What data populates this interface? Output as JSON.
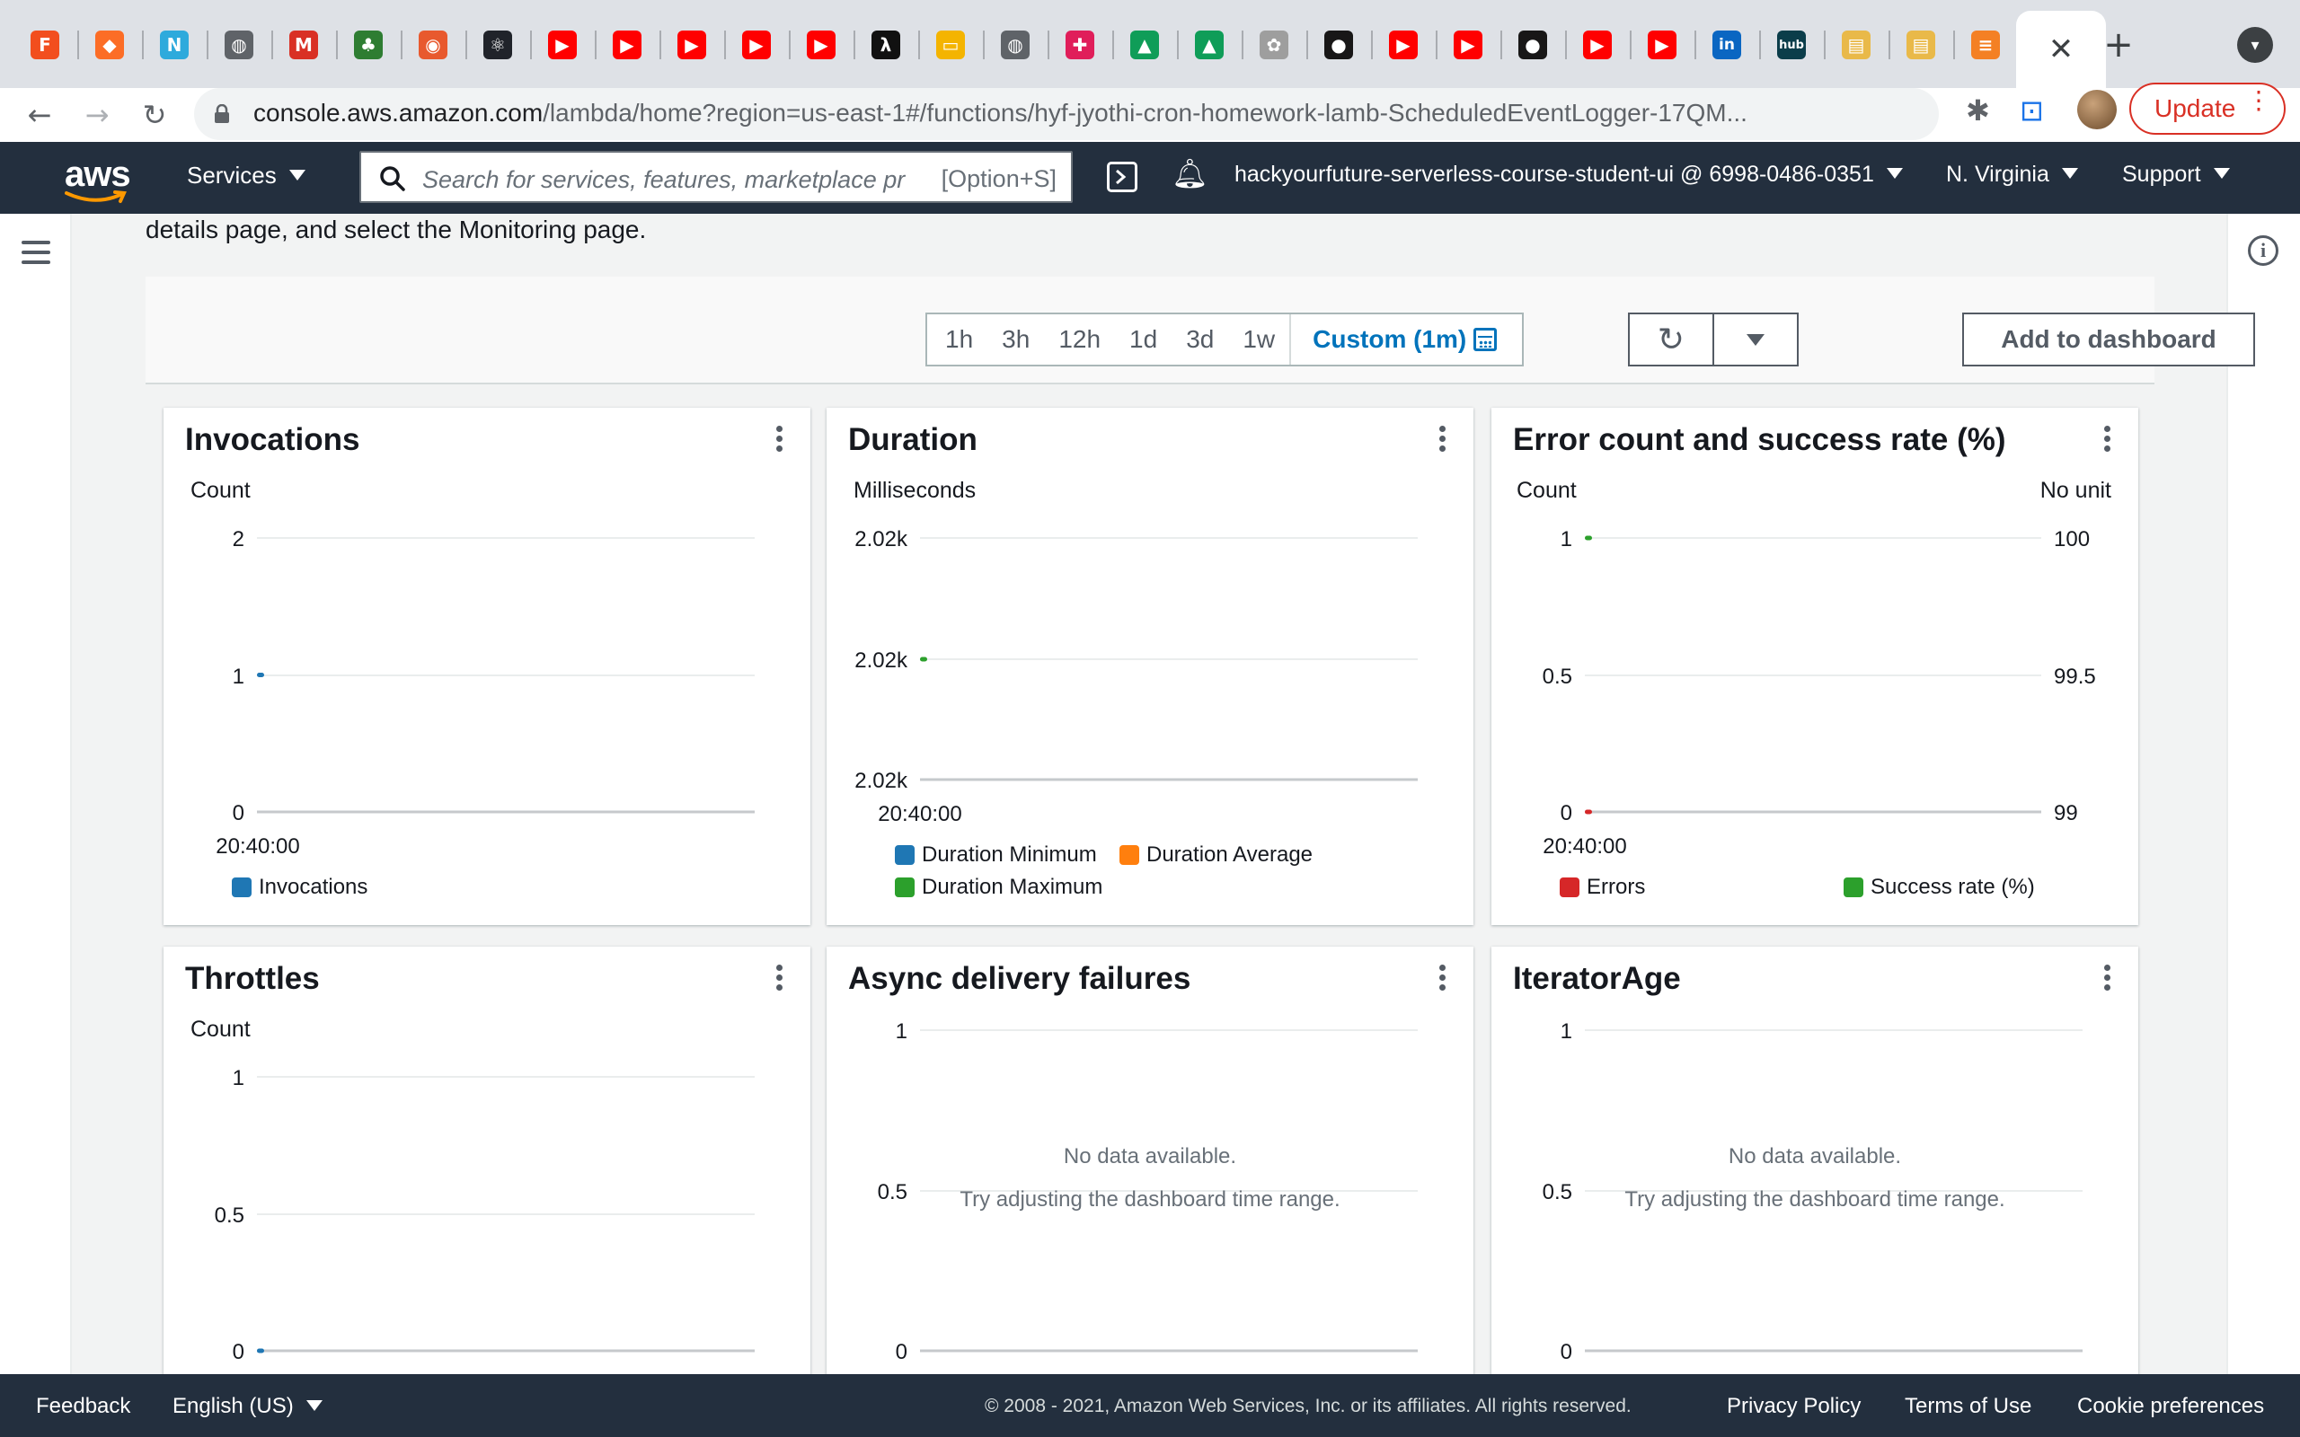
{
  "browser": {
    "tabs": [
      {
        "icon": "figma-icon",
        "color": "#f24e1e",
        "glyph": "F"
      },
      {
        "icon": "gitlab-icon",
        "color": "#fc6d26",
        "glyph": "◆"
      },
      {
        "icon": "notion-icon",
        "color": "#2eaadc",
        "glyph": "N"
      },
      {
        "icon": "globe-icon",
        "color": "#5f6368",
        "glyph": "◍"
      },
      {
        "icon": "gmail-icon",
        "color": "#d93025",
        "glyph": "M"
      },
      {
        "icon": "tree-icon",
        "color": "#2e7d32",
        "glyph": "♣"
      },
      {
        "icon": "app-icon",
        "color": "#e8592e",
        "glyph": "◉"
      },
      {
        "icon": "react-icon",
        "color": "#20232a",
        "glyph": "⚛"
      },
      {
        "icon": "youtube-icon",
        "color": "#ff0000",
        "glyph": "▶"
      },
      {
        "icon": "youtube-icon",
        "color": "#ff0000",
        "glyph": "▶"
      },
      {
        "icon": "youtube-icon",
        "color": "#ff0000",
        "glyph": "▶"
      },
      {
        "icon": "youtube-icon",
        "color": "#ff0000",
        "glyph": "▶"
      },
      {
        "icon": "youtube-icon",
        "color": "#ff0000",
        "glyph": "▶"
      },
      {
        "icon": "lambda-icon",
        "color": "#111111",
        "glyph": "λ"
      },
      {
        "icon": "slides-icon",
        "color": "#f4b400",
        "glyph": "▭"
      },
      {
        "icon": "globe-icon",
        "color": "#5f6368",
        "glyph": "◍"
      },
      {
        "icon": "slack-icon",
        "color": "#e01e5a",
        "glyph": "✚"
      },
      {
        "icon": "drive-icon",
        "color": "#0f9d58",
        "glyph": "▲"
      },
      {
        "icon": "drive-icon",
        "color": "#0f9d58",
        "glyph": "▲"
      },
      {
        "icon": "tree-icon",
        "color": "#9e9e9e",
        "glyph": "✿"
      },
      {
        "icon": "github-icon",
        "color": "#181717",
        "glyph": "●"
      },
      {
        "icon": "youtube-icon",
        "color": "#ff0000",
        "glyph": "▶"
      },
      {
        "icon": "youtube-icon",
        "color": "#ff0000",
        "glyph": "▶"
      },
      {
        "icon": "github-icon",
        "color": "#181717",
        "glyph": "●"
      },
      {
        "icon": "youtube-icon",
        "color": "#ff0000",
        "glyph": "▶"
      },
      {
        "icon": "youtube-icon",
        "color": "#ff0000",
        "glyph": "▶"
      },
      {
        "icon": "linkedin-icon",
        "color": "#0a66c2",
        "glyph": "in"
      },
      {
        "icon": "hub-icon",
        "color": "#0b3d4a",
        "glyph": "hub"
      },
      {
        "icon": "book-icon",
        "color": "#e9b949",
        "glyph": "▤"
      },
      {
        "icon": "book-icon",
        "color": "#e9b949",
        "glyph": "▤"
      },
      {
        "icon": "stackoverflow-icon",
        "color": "#f48024",
        "glyph": "≡"
      }
    ],
    "active_tab_close": "✕",
    "new_tab": "+",
    "url_host": "console.aws.amazon.com",
    "url_path": "/lambda/home?region=us-east-1#/functions/hyf-jyothi-cron-homework-lamb-ScheduledEventLogger-17QM...",
    "update_label": "Update"
  },
  "aws": {
    "logo": "aws",
    "services_label": "Services",
    "search_placeholder": "Search for services, features, marketplace pr",
    "search_shortcut": "[Option+S]",
    "account": "hackyourfuture-serverless-course-student-ui @ 6998-0486-0351",
    "region": "N. Virginia",
    "support": "Support"
  },
  "page": {
    "intro_text": "details page, and select the Monitoring page.",
    "time_ranges": [
      "1h",
      "3h",
      "12h",
      "1d",
      "3d",
      "1w"
    ],
    "custom_range": "Custom (1m)",
    "add_to_dashboard": "Add to dashboard"
  },
  "widgets": {
    "invocations": {
      "title": "Invocations",
      "unit": "Count",
      "y_ticks": [
        "2",
        "1",
        "0"
      ],
      "x_tick": "20:40:00",
      "legend": [
        "Invocations"
      ]
    },
    "duration": {
      "title": "Duration",
      "unit": "Milliseconds",
      "y_ticks": [
        "2.02k",
        "2.02k",
        "2.02k"
      ],
      "x_tick": "20:40:00",
      "legend": [
        "Duration Minimum",
        "Duration Average",
        "Duration Maximum"
      ]
    },
    "errors": {
      "title": "Error count and success rate (%)",
      "unit_left": "Count",
      "unit_right": "No unit",
      "y_ticks_left": [
        "1",
        "0.5",
        "0"
      ],
      "y_ticks_right": [
        "100",
        "99.5",
        "99"
      ],
      "x_tick": "20:40:00",
      "legend": [
        "Errors",
        "Success rate (%)"
      ]
    },
    "throttles": {
      "title": "Throttles",
      "unit": "Count",
      "y_ticks": [
        "1",
        "0.5",
        "0"
      ]
    },
    "async": {
      "title": "Async delivery failures",
      "y_ticks": [
        "1",
        "0.5",
        "0"
      ],
      "no_data": "No data available.",
      "hint": "Try adjusting the dashboard time range."
    },
    "iterator": {
      "title": "IteratorAge",
      "y_ticks": [
        "1",
        "0.5",
        "0"
      ],
      "no_data": "No data available.",
      "hint": "Try adjusting the dashboard time range."
    }
  },
  "colors": {
    "blue": "#1f77b4",
    "orange": "#ff7f0e",
    "green": "#2ca02c",
    "red": "#d62728"
  },
  "chart_data": [
    {
      "type": "line",
      "title": "Invocations",
      "ylabel": "Count",
      "ylim": [
        0,
        2
      ],
      "x": [
        "20:40:00"
      ],
      "series": [
        {
          "name": "Invocations",
          "values": [
            1
          ]
        }
      ]
    },
    {
      "type": "line",
      "title": "Duration",
      "ylabel": "Milliseconds",
      "x": [
        "20:40:00"
      ],
      "series": [
        {
          "name": "Duration Minimum",
          "values": [
            2020
          ]
        },
        {
          "name": "Duration Average",
          "values": [
            2020
          ]
        },
        {
          "name": "Duration Maximum",
          "values": [
            2020
          ]
        }
      ]
    },
    {
      "type": "line",
      "title": "Error count and success rate (%)",
      "ylabel": "Count",
      "ylim": [
        0,
        1
      ],
      "y2label": "No unit",
      "y2lim": [
        99,
        100
      ],
      "x": [
        "20:40:00"
      ],
      "series": [
        {
          "name": "Errors",
          "values": [
            0
          ]
        },
        {
          "name": "Success rate (%)",
          "values": [
            100
          ]
        }
      ]
    },
    {
      "type": "line",
      "title": "Throttles",
      "ylabel": "Count",
      "ylim": [
        0,
        1
      ],
      "series": [
        {
          "name": "Throttles",
          "values": [
            0
          ]
        }
      ]
    },
    {
      "type": "line",
      "title": "Async delivery failures",
      "ylim": [
        0,
        1
      ],
      "series": []
    },
    {
      "type": "line",
      "title": "IteratorAge",
      "ylim": [
        0,
        1
      ],
      "series": []
    }
  ],
  "footer": {
    "feedback": "Feedback",
    "language": "English (US)",
    "copyright": "© 2008 - 2021, Amazon Web Services, Inc. or its affiliates. All rights reserved.",
    "privacy": "Privacy Policy",
    "terms": "Terms of Use",
    "cookies": "Cookie preferences"
  }
}
